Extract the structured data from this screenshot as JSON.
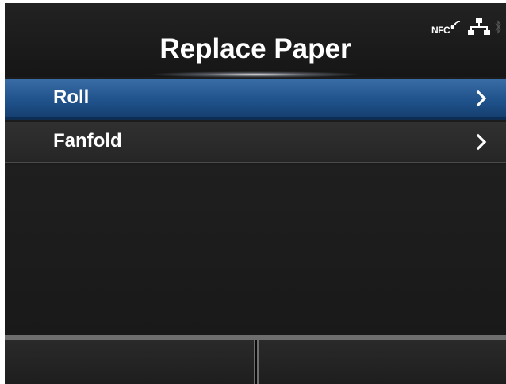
{
  "header": {
    "title": "Replace Paper",
    "status": {
      "nfc_label": "NFC",
      "icons": [
        "nfc-icon",
        "network-icon",
        "bluetooth-icon"
      ]
    }
  },
  "menu": {
    "items": [
      {
        "label": "Roll",
        "selected": true,
        "icon": "chevron-right-icon"
      },
      {
        "label": "Fanfold",
        "selected": false,
        "icon": "chevron-right-icon"
      }
    ]
  },
  "softkeys": {
    "left_label": "",
    "right_label": ""
  },
  "colors": {
    "background": "#1c1c1c",
    "selected_row": "#20538c",
    "text": "#ffffff",
    "softkey_separator": "#6e6e6e"
  }
}
